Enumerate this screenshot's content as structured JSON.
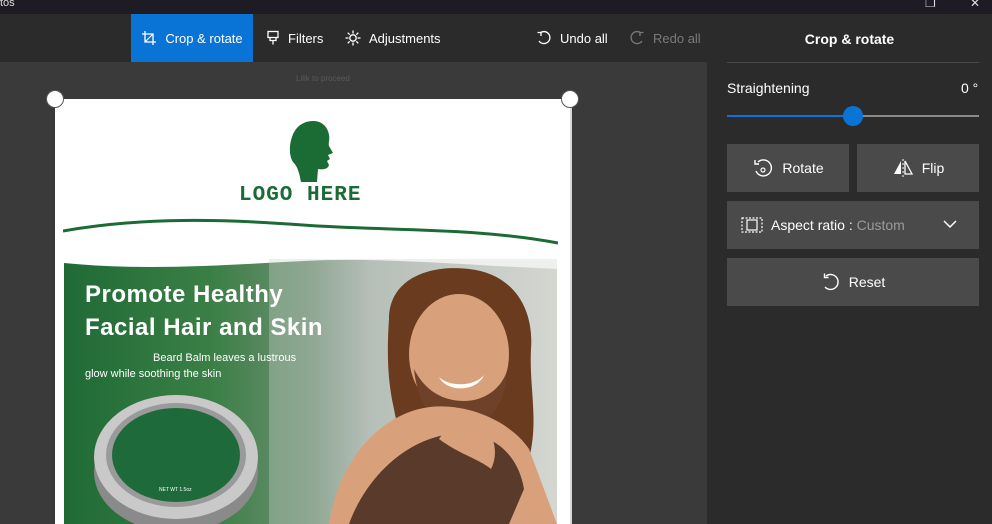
{
  "window": {
    "title": "tos"
  },
  "toolbar": {
    "crop_label": "Crop & rotate",
    "filters_label": "Filters",
    "adjustments_label": "Adjustments",
    "undo_label": "Undo all",
    "redo_label": "Redo all",
    "accent": "#0a74d6"
  },
  "canvas": {
    "hint": "Lilik to proceed"
  },
  "photo": {
    "logo_text": "LOGO HERE",
    "headline_1": "Promote Healthy",
    "headline_2": "Facial Hair and Skin",
    "sub_1": "Beard Balm leaves a lustrous",
    "sub_2": "glow while soothing the skin",
    "tin_label": "NET WT 1.5oz",
    "brand_green": "#1b6b34"
  },
  "panel": {
    "title": "Crop & rotate",
    "straightening_label": "Straightening",
    "straightening_value": "0 °",
    "straightening_fraction": 0.5,
    "rotate_label": "Rotate",
    "flip_label": "Flip",
    "aspect_label": "Aspect ratio : ",
    "aspect_value": "Custom",
    "reset_label": "Reset"
  }
}
